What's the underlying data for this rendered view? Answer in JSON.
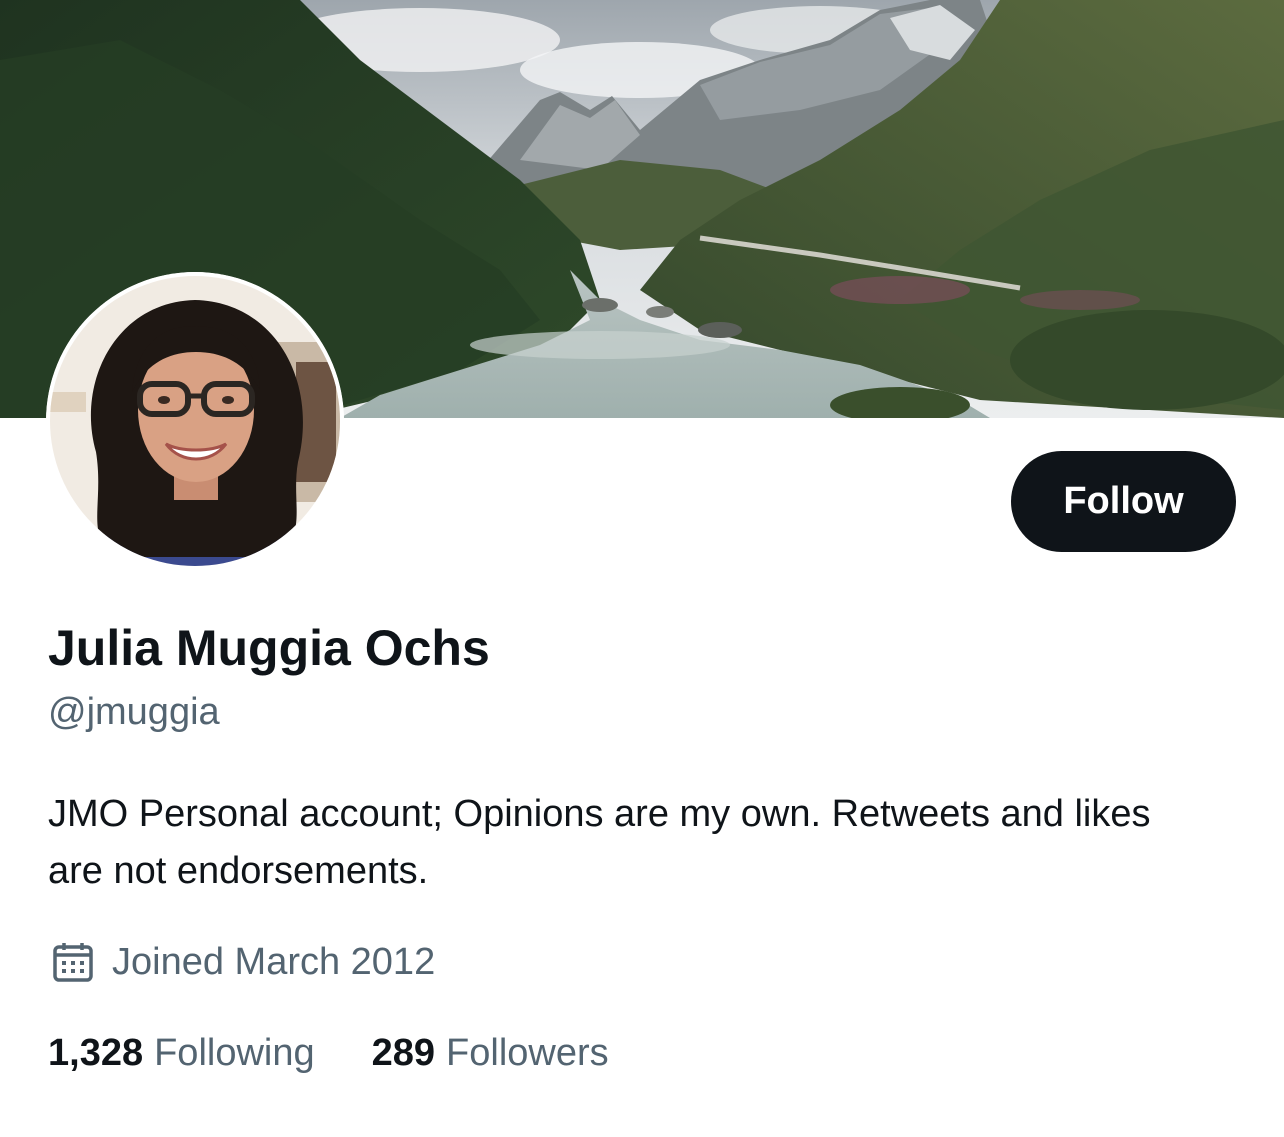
{
  "profile": {
    "display_name": "Julia Muggia Ochs",
    "handle": "@jmuggia",
    "bio": "JMO Personal account; Opinions are my own. Retweets and likes are not endorsements.",
    "joined": "Joined March 2012",
    "following_count": "1,328",
    "following_label": "Following",
    "followers_count": "289",
    "followers_label": "Followers"
  },
  "actions": {
    "follow_label": "Follow"
  },
  "icons": {
    "joined": "calendar-icon"
  },
  "colors": {
    "primary_text": "#0f1419",
    "secondary_text": "#536471",
    "follow_button_bg": "#0f1419",
    "follow_button_text": "#ffffff",
    "background": "#ffffff"
  }
}
